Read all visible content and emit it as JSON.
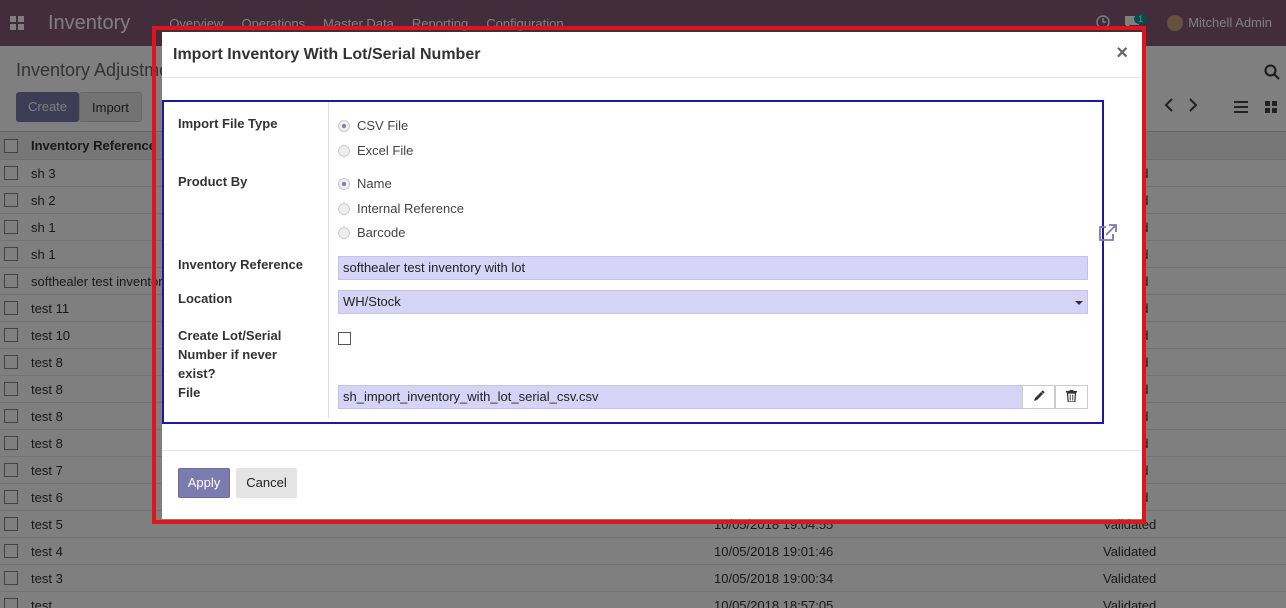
{
  "navbar": {
    "brand": "Inventory",
    "menu": [
      "Overview",
      "Operations",
      "Master Data",
      "Reporting",
      "Configuration"
    ],
    "chat_count": "1",
    "user": "Mitchell Admin"
  },
  "control_panel": {
    "breadcrumb": "Inventory Adjustme",
    "create_label": "Create",
    "import_label": "Import"
  },
  "list": {
    "header_ref": "Inventory Reference",
    "header_status": "s",
    "rows": [
      {
        "ref": "sh 3",
        "date": "",
        "status": "alidated"
      },
      {
        "ref": "sh 2",
        "date": "",
        "status": "alidated"
      },
      {
        "ref": "sh 1",
        "date": "",
        "status": "alidated"
      },
      {
        "ref": "sh 1",
        "date": "",
        "status": "alidated"
      },
      {
        "ref": "softhealer test inventor",
        "date": "",
        "status": "alidated"
      },
      {
        "ref": "test 11",
        "date": "",
        "status": "alidated"
      },
      {
        "ref": "test 10",
        "date": "",
        "status": "alidated"
      },
      {
        "ref": "test 8",
        "date": "",
        "status": "alidated"
      },
      {
        "ref": "test 8",
        "date": "",
        "status": "alidated"
      },
      {
        "ref": "test 8",
        "date": "",
        "status": "alidated"
      },
      {
        "ref": "test 8",
        "date": "",
        "status": "alidated"
      },
      {
        "ref": "test 7",
        "date": "",
        "status": "alidated"
      },
      {
        "ref": "test 6",
        "date": "",
        "status": "alidated"
      },
      {
        "ref": "test 5",
        "date": "10/05/2018 19:04:55",
        "status": "Validated"
      },
      {
        "ref": "test 4",
        "date": "10/05/2018 19:01:46",
        "status": "Validated"
      },
      {
        "ref": "test 3",
        "date": "10/05/2018 19:00:34",
        "status": "Validated"
      },
      {
        "ref": "test",
        "date": "10/05/2018 18:57:05",
        "status": "Validated"
      }
    ]
  },
  "modal": {
    "title": "Import Inventory With Lot/Serial Number",
    "close": "×",
    "labels": {
      "file_type": "Import File Type",
      "product_by": "Product By",
      "inventory_reference": "Inventory Reference",
      "location": "Location",
      "create_lot_line1": "Create Lot/Serial",
      "create_lot_line2": "Number if never",
      "create_lot_line3": "exist?",
      "file": "File"
    },
    "file_type_options": [
      "CSV File",
      "Excel File"
    ],
    "file_type_selected": "CSV File",
    "product_by_options": [
      "Name",
      "Internal Reference",
      "Barcode"
    ],
    "product_by_selected": "Name",
    "inventory_reference_value": "softhealer test inventory with lot",
    "location_value": "WH/Stock",
    "create_lot_checked": false,
    "file_value": "sh_import_inventory_with_lot_serial_csv.csv",
    "apply_label": "Apply",
    "cancel_label": "Cancel"
  },
  "colors": {
    "navbar": "#875a7b",
    "primary": "#7c7bad",
    "field_bg": "#d5d4f7",
    "highlight_red": "#e0141b",
    "highlight_blue": "#1a1aa6"
  }
}
